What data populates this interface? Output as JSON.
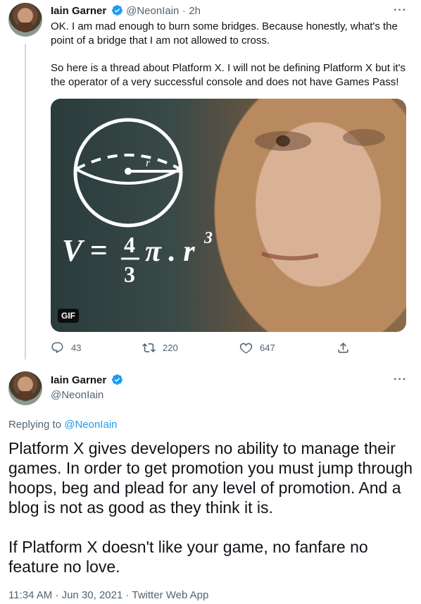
{
  "tweet1": {
    "display_name": "Iain Garner",
    "handle": "@NeonIain",
    "time": "2h",
    "paragraph1": "OK. I am mad enough to burn some bridges. Because honestly, what's the point of a bridge that I am not allowed to cross.",
    "paragraph2": "So here is a thread about Platform X. I will not be defining Platform X but it's the operator of a very successful console and does not have Games Pass!",
    "media": {
      "gif_label": "GIF",
      "formula": "V = 4/3 π . r³",
      "formula_lhs": "V =",
      "formula_num": "4",
      "formula_den": "3",
      "formula_rhs": "π . r",
      "formula_exp": "3"
    },
    "replies": "43",
    "retweets": "220",
    "likes": "647"
  },
  "tweet2": {
    "display_name": "Iain Garner",
    "handle": "@NeonIain",
    "replying_prefix": "Replying to",
    "replying_to": "@NeonIain",
    "paragraph1": "Platform X gives developers no ability to manage their games. In order to get promotion you must jump through hoops, beg and plead for any level of promotion. And a blog is not as good as they think it is.",
    "paragraph2": "If Platform X doesn't like your game, no fanfare no feature no love.",
    "meta": "11:34 AM · Jun 30, 2021 · Twitter Web App"
  },
  "colors": {
    "accent": "#1d9bf0",
    "muted": "#536471",
    "text": "#0f1419"
  }
}
